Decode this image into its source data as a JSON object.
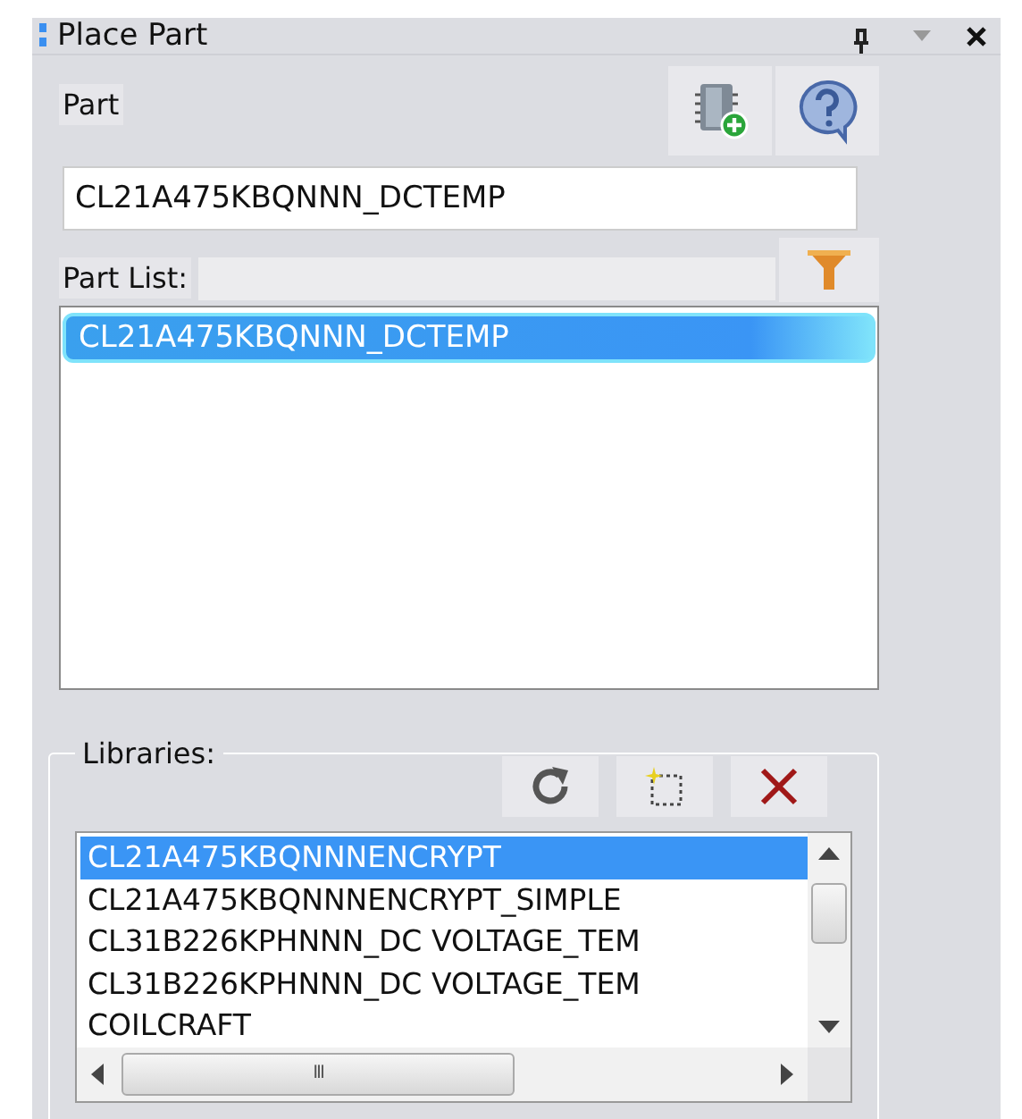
{
  "panel": {
    "title": "Place Part"
  },
  "part": {
    "label": "Part",
    "value": "CL21A475KBQNNN_DCTEMP"
  },
  "part_list": {
    "label": "Part List:",
    "items": [
      {
        "text": "CL21A475KBQNNN_DCTEMP",
        "selected": true
      }
    ]
  },
  "libraries": {
    "label": "Libraries:",
    "items": [
      {
        "text": "CL21A475KBQNNNENCRYPT",
        "selected": true
      },
      {
        "text": "CL21A475KBQNNNENCRYPT_SIMPLE",
        "selected": false
      },
      {
        "text": "CL31B226KPHNNN_DC VOLTAGE_TEM",
        "selected": false
      },
      {
        "text": "CL31B226KPHNNN_DC VOLTAGE_TEM",
        "selected": false
      },
      {
        "text": "COILCRAFT",
        "selected": false
      }
    ],
    "scrollbar_glyph": "III"
  }
}
